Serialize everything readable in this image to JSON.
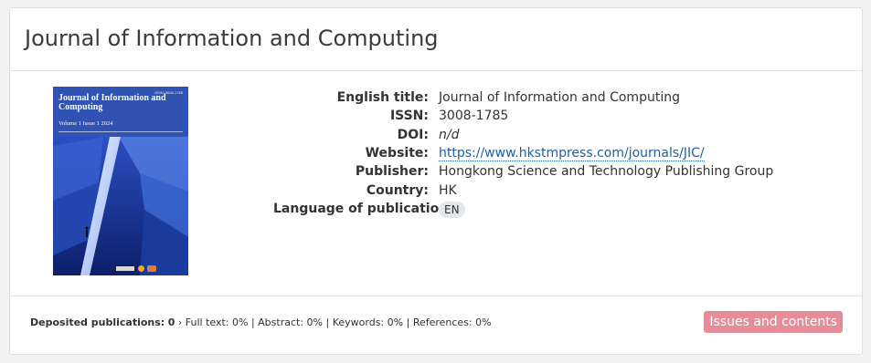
{
  "journal": {
    "title": "Journal of Information and Computing"
  },
  "cover": {
    "issn_text": "ISSN: 3008-1785",
    "journal_title": "Journal of Information and Computing",
    "volume_text": "Volume 1 Issue 1 2024"
  },
  "details": [
    {
      "label": "English title:",
      "value": "Journal of Information and Computing"
    },
    {
      "label": "ISSN:",
      "value": "3008-1785"
    },
    {
      "label": "DOI:",
      "value": "n/d"
    },
    {
      "label": "Website:",
      "value": "https://www.hkstmpress.com/journals/JIC/"
    },
    {
      "label": "Publisher:",
      "value": "Hongkong Science and Technology Publishing Group"
    },
    {
      "label": "Country:",
      "value": "HK"
    },
    {
      "label": "Language of publication:",
      "value": "EN"
    }
  ],
  "footer": {
    "deposited_label": "Deposited publications:",
    "deposited_count": "0",
    "arrow": "›",
    "full_text": "Full text: 0%",
    "abstract": "Abstract: 0%",
    "keywords": "Keywords: 0%",
    "references": "References: 0%",
    "separator": "|",
    "issues_button": "Issues and contents"
  },
  "colors": {
    "link": "#1f5ea8",
    "button_bg": "#e58e99",
    "cover_blue": "#1b3aa0"
  }
}
